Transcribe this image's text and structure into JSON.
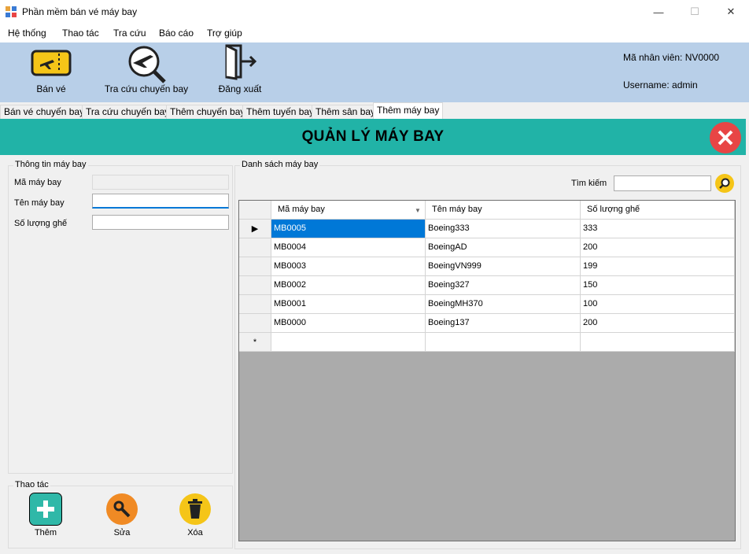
{
  "window": {
    "title": "Phần mềm bán vé máy bay"
  },
  "menu": [
    "Hệ thống",
    "Thao tác",
    "Tra cứu",
    "Báo cáo",
    "Trợ giúp"
  ],
  "toolbar": {
    "sell_label": "Bán vé",
    "lookup_label": "Tra cứu chuyến bay",
    "logout_label": "Đăng xuất",
    "employee_id": "Mã nhân viên: NV0000",
    "username": "Username: admin"
  },
  "tabs": [
    "Bán vé chuyến bay",
    "Tra cứu chuyến bay",
    "Thêm chuyến bay",
    "Thêm tuyến bay",
    "Thêm sân bay",
    "Thêm máy bay"
  ],
  "header": {
    "title": "QUẢN LÝ MÁY BAY"
  },
  "info": {
    "group_title": "Thông tin máy bay",
    "id_label": "Mã máy bay",
    "name_label": "Tên máy bay",
    "seats_label": "Số lượng ghế",
    "id_value": "",
    "name_value": "",
    "seats_value": ""
  },
  "actions": {
    "group_title": "Thao tác",
    "add_label": "Thêm",
    "edit_label": "Sửa",
    "delete_label": "Xóa"
  },
  "list": {
    "group_title": "Danh sách máy bay",
    "search_label": "Tìm kiếm",
    "search_value": "",
    "columns": [
      "Mã máy bay",
      "Tên máy bay",
      "Số lượng ghế"
    ],
    "rows": [
      [
        "MB0005",
        "Boeing333",
        "333"
      ],
      [
        "MB0004",
        "BoeingAD",
        "200"
      ],
      [
        "MB0003",
        "BoeingVN999",
        "199"
      ],
      [
        "MB0002",
        "Boeing327",
        "150"
      ],
      [
        "MB0001",
        "BoeingMH370",
        "100"
      ],
      [
        "MB0000",
        "Boeing137",
        "200"
      ]
    ],
    "new_row_marker": "*"
  },
  "colors": {
    "header": "#21b3a7",
    "toolbar": "#b8cfe8",
    "selection": "#0078d7"
  }
}
